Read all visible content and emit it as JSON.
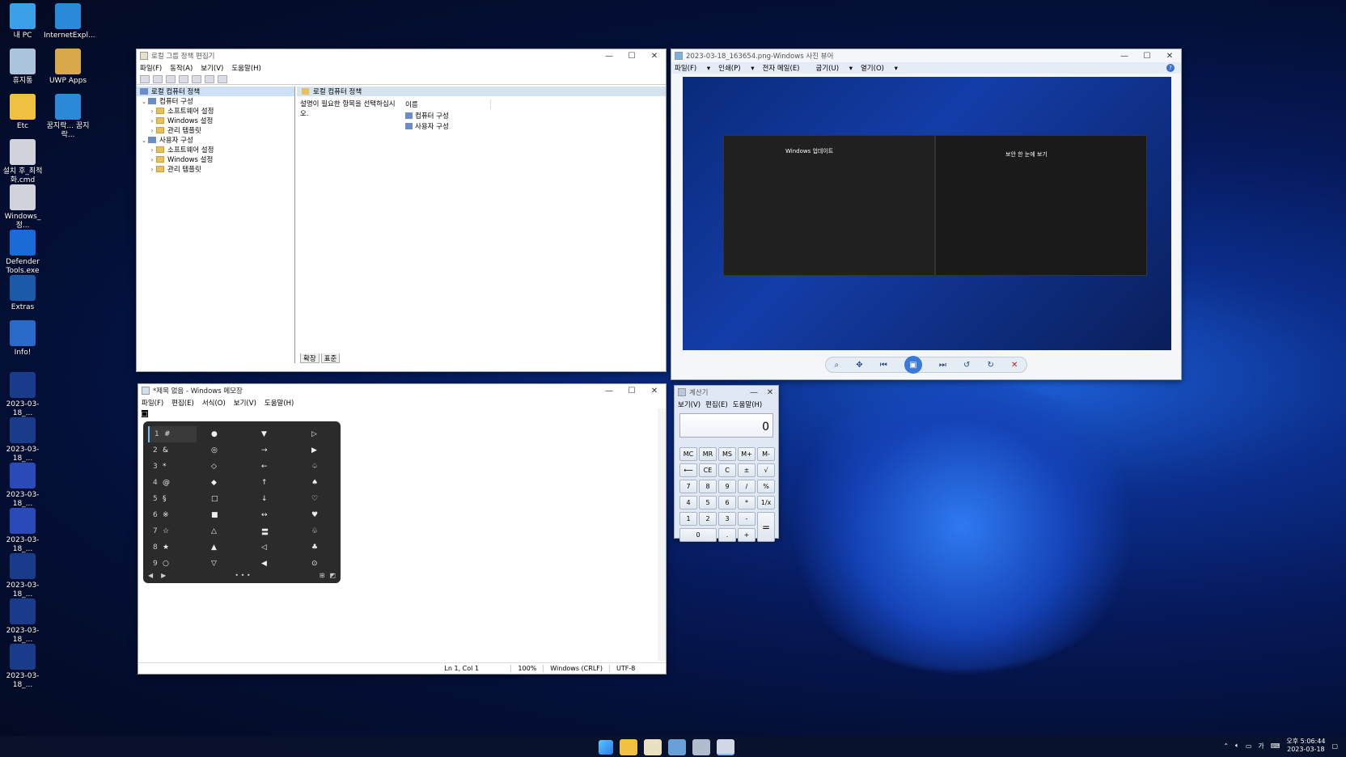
{
  "desktop": {
    "icons": [
      {
        "label": "내 PC",
        "icon": "this-pc-icon",
        "color": "#3aa0e8"
      },
      {
        "label": "InternetExpl...",
        "icon": "internet-explorer-icon",
        "color": "#2a8ad8"
      },
      {
        "label": "휴지통",
        "icon": "recycle-bin-icon",
        "color": "#aac4dc"
      },
      {
        "label": "UWP Apps",
        "icon": "folder-box-icon",
        "color": "#d8a84a"
      },
      {
        "label": "Etc",
        "icon": "folder-icon",
        "color": "#f0c040"
      },
      {
        "label": "꿈지락... 꿈지락...",
        "icon": "internet-explorer-icon",
        "color": "#2a8ad8"
      },
      {
        "label": "설치 후_최적화.cmd",
        "icon": "cmd-gear-icon",
        "color": "#d0d4da"
      },
      {
        "label": "Windows_정...",
        "icon": "cmd-gear-icon",
        "color": "#d0d4da"
      },
      {
        "label": "Defender Tools.exe",
        "icon": "shield-icon",
        "color": "#1a6ad8"
      },
      {
        "label": "Extras",
        "icon": "extras-icon",
        "color": "#1a5aa8"
      },
      {
        "label": "Info!",
        "icon": "info-globe-icon",
        "color": "#2a6ac8"
      },
      {
        "label": "2023-03-18_...",
        "icon": "image-thumb-icon",
        "color": "#1a3a8a"
      },
      {
        "label": "2023-03-18_...",
        "icon": "image-thumb-icon",
        "color": "#1a3a8a"
      },
      {
        "label": "2023-03-18_...",
        "icon": "image-thumb-icon",
        "color": "#2a4ab8"
      },
      {
        "label": "2023-03-18_...",
        "icon": "image-thumb-icon",
        "color": "#2a4ab8"
      },
      {
        "label": "2023-03-18_...",
        "icon": "image-thumb-icon",
        "color": "#1a3a8a"
      },
      {
        "label": "2023-03-18_...",
        "icon": "image-thumb-icon",
        "color": "#1a3a8a"
      },
      {
        "label": "2023-03-18_...",
        "icon": "image-thumb-icon",
        "color": "#1a3a8a"
      }
    ]
  },
  "gpedit": {
    "title": "로컬 그룹 정책 편집기",
    "menu": [
      "파일(F)",
      "동작(A)",
      "보기(V)",
      "도움말(H)"
    ],
    "tree": [
      {
        "label": "로컬 컴퓨터 정책",
        "level": 0
      },
      {
        "label": "컴퓨터 구성",
        "level": 1
      },
      {
        "label": "소프트웨어 설정",
        "level": 2
      },
      {
        "label": "Windows 설정",
        "level": 2
      },
      {
        "label": "관리 템플릿",
        "level": 2
      },
      {
        "label": "사용자 구성",
        "level": 1
      },
      {
        "label": "소프트웨어 설정",
        "level": 2
      },
      {
        "label": "Windows 설정",
        "level": 2
      },
      {
        "label": "관리 템플릿",
        "level": 2
      }
    ],
    "right_header": "로컬 컴퓨터 정책",
    "description": "설명이 필요한 항목을 선택하십시오.",
    "column_name": "이름",
    "items": [
      "컴퓨터 구성",
      "사용자 구성"
    ],
    "tabs": [
      "확장",
      "표준"
    ]
  },
  "photo": {
    "title": "2023-03-18_163654.png-Windows 사진 뷰어",
    "menu": [
      "파일(F)",
      "인쇄(P)",
      "전자 메일(E)",
      "굽기(U)",
      "열기(O)"
    ],
    "screenshot_title": "Windows 업데이트",
    "screenshot_right_title": "보안 한 눈에 보기"
  },
  "notepad": {
    "title": "*제목 없음 - Windows 메모장",
    "menu": [
      "파일(F)",
      "편집(E)",
      "서식(O)",
      "보기(V)",
      "도움말(H)"
    ],
    "text": "□",
    "status": [
      "Ln 1, Col 1",
      "100%",
      "Windows (CRLF)",
      "UTF-8"
    ],
    "symbols": [
      [
        "1",
        "#",
        "●",
        "▼",
        "▷"
      ],
      [
        "2",
        "&",
        "◎",
        "→",
        "▶"
      ],
      [
        "3",
        "*",
        "◇",
        "←",
        "♤"
      ],
      [
        "4",
        "@",
        "◆",
        "↑",
        "♠"
      ],
      [
        "5",
        "§",
        "□",
        "↓",
        "♡"
      ],
      [
        "6",
        "※",
        "■",
        "↔",
        "♥"
      ],
      [
        "7",
        "☆",
        "△",
        "〓",
        "♧"
      ],
      [
        "8",
        "★",
        "▲",
        "◁",
        "♣"
      ],
      [
        "9",
        "○",
        "▽",
        "◀",
        "⊙"
      ]
    ]
  },
  "calculator": {
    "title": "계산기",
    "menu": [
      "보기(V)",
      "편집(E)",
      "도움말(H)"
    ],
    "display": "0",
    "buttons": [
      [
        "MC",
        "MR",
        "MS",
        "M+",
        "M-"
      ],
      [
        "⟵",
        "CE",
        "C",
        "±",
        "√"
      ],
      [
        "7",
        "8",
        "9",
        "/",
        "%"
      ],
      [
        "4",
        "5",
        "6",
        "*",
        "1/x"
      ],
      [
        "1",
        "2",
        "3",
        "-",
        "="
      ],
      [
        "0",
        ".",
        "+"
      ]
    ]
  },
  "taskbar": {
    "time": "오후 5:06:44",
    "date": "2023-03-18",
    "ime": "가"
  }
}
